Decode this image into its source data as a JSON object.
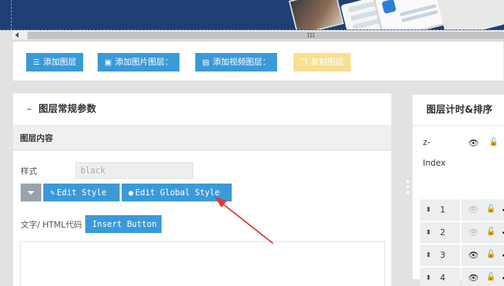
{
  "scrollbar": {
    "grip": "III"
  },
  "toolbar": {
    "buttons": [
      {
        "label": "添加图层",
        "icon": "layers-icon",
        "state": "enabled"
      },
      {
        "label": "添加图片图层：",
        "icon": "image-icon",
        "state": "enabled"
      },
      {
        "label": "添加视频图层：",
        "icon": "film-icon",
        "state": "enabled"
      },
      {
        "label": "复制图层",
        "icon": "copy-layers-icon",
        "state": "disabled"
      }
    ]
  },
  "left_panel": {
    "collapse_symbol": "–",
    "title": "图层常规参数",
    "section_title": "图层内容",
    "style_label": "样式",
    "style_value": "black",
    "edit_style_label": "Edit Style",
    "edit_global_style_label": "Edit Global Style",
    "html_label": "文字/ HTML代码",
    "insert_button_label": "Insert Button",
    "html_value": ""
  },
  "right_panel": {
    "title": "图层计时&排序",
    "z_label": "z-",
    "index_label": "Index",
    "rows": [
      {
        "n": "1",
        "visible": false
      },
      {
        "n": "2",
        "visible": false
      },
      {
        "n": "3",
        "visible": true
      },
      {
        "n": "4",
        "visible": true
      }
    ]
  },
  "colors": {
    "primary_button": "#3a9ad9",
    "disabled_button": "#f7e08f",
    "annotation_arrow": "#e03a3a"
  }
}
